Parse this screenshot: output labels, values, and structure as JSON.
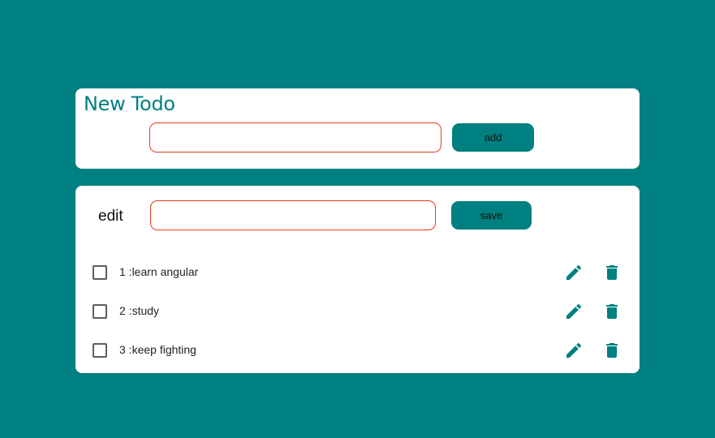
{
  "new_todo": {
    "title": "New Todo",
    "input_value": "",
    "add_label": "add"
  },
  "edit_panel": {
    "label": "edit",
    "input_value": "",
    "save_label": "save"
  },
  "todos": [
    {
      "text": "1 :learn angular",
      "checked": false
    },
    {
      "text": "2 :study",
      "checked": false
    },
    {
      "text": "3 :keep fighting",
      "checked": false
    }
  ],
  "colors": {
    "background": "#008080",
    "accent": "#008080",
    "input_border": "#e53b1e"
  },
  "icons": {
    "edit": "pencil-icon",
    "delete": "trash-icon"
  }
}
